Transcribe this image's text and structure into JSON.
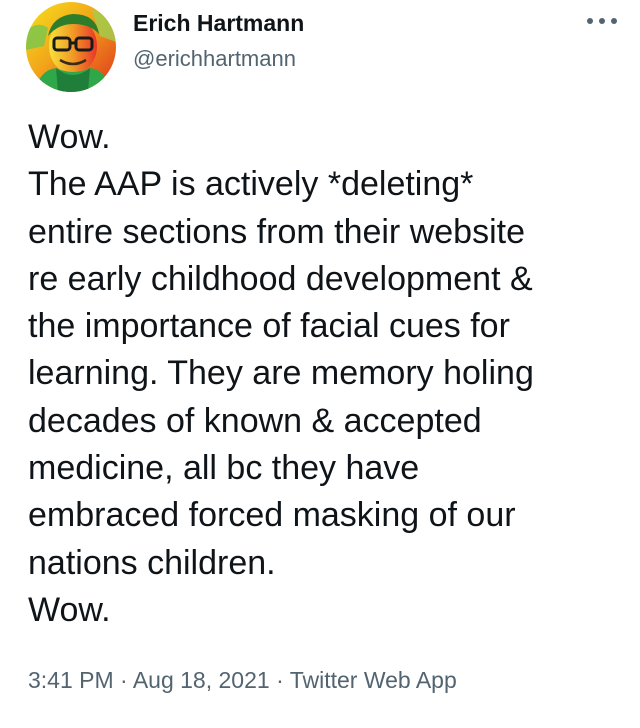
{
  "author": {
    "name": "Erich Hartmann",
    "handle": "@erichhartmann",
    "avatar_icon": "profile-photo-avatar"
  },
  "menu": {
    "icon": "more-options-icon"
  },
  "tweet": {
    "lines": [
      "Wow.",
      "The AAP is actively *deleting*",
      "entire sections from their website",
      "re early childhood development &",
      "the importance of facial cues for",
      "learning. They are memory holing",
      "decades of known & accepted",
      "medicine, all bc they have",
      "embraced forced masking of our",
      "nations children.",
      "Wow."
    ]
  },
  "meta": {
    "time": "3:41 PM",
    "separator": "·",
    "date": "Aug 18, 2021",
    "source": "Twitter Web App"
  },
  "colors": {
    "text": "#0f1419",
    "secondary": "#536471",
    "background": "#ffffff"
  }
}
